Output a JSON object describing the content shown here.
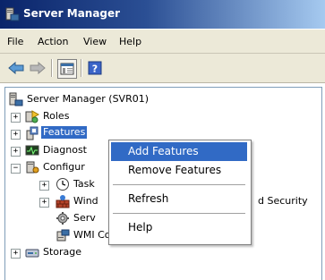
{
  "window": {
    "title": "Server Manager"
  },
  "menubar": {
    "items": [
      "File",
      "Action",
      "View",
      "Help"
    ]
  },
  "toolbar": {
    "buttons": [
      "back-arrow-icon",
      "forward-arrow-icon",
      "show-hide-console-tree-icon",
      "help-icon"
    ]
  },
  "tree": {
    "root": "Server Manager (SVR01)",
    "roles": "Roles",
    "features": "Features",
    "diagnostics": "Diagnost",
    "configuration": "Configur",
    "task_scheduler": "Task",
    "windows_firewall": "Wind",
    "windows_firewall_suffix": "d Security",
    "services": "Serv",
    "wmi_control": "WMI Control",
    "storage": "Storage",
    "expand_glyph": "+",
    "collapse_glyph": "−"
  },
  "context_menu": {
    "items": [
      "Add Features",
      "Remove Features",
      "Refresh",
      "Help"
    ],
    "highlighted": "Add Features"
  },
  "colors": {
    "title_bar": "#0a246a",
    "selection": "#316ac5",
    "chrome": "#ece9d8"
  }
}
